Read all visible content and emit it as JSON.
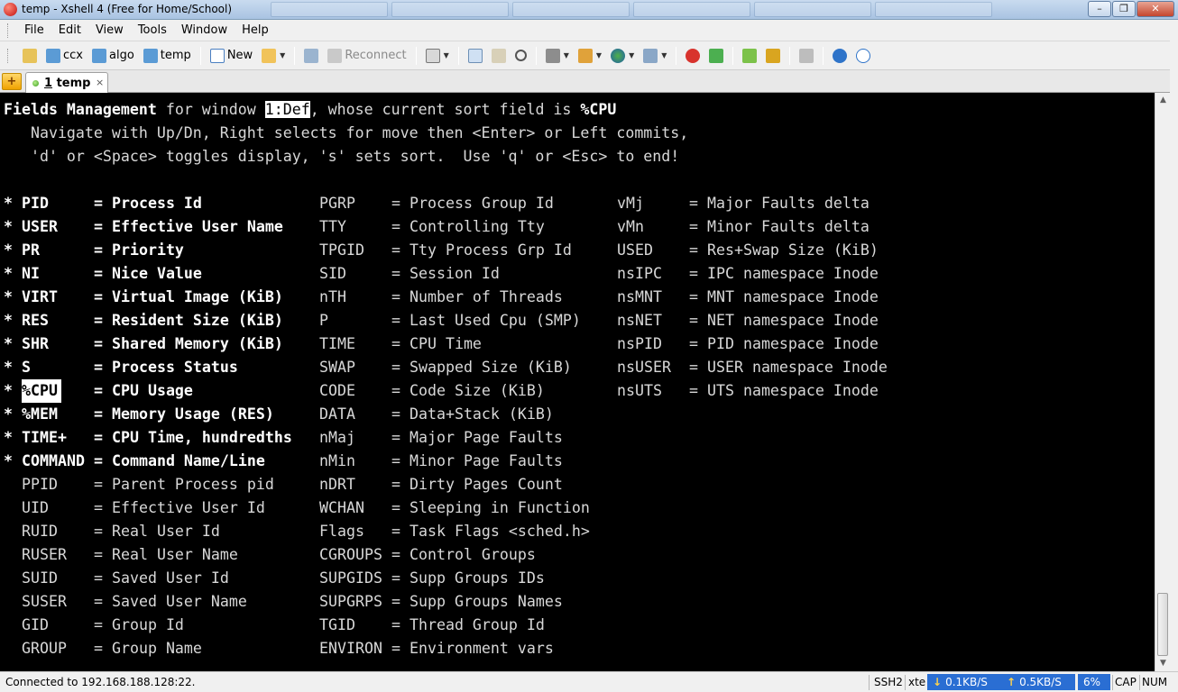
{
  "window": {
    "title": "temp - Xshell 4 (Free for Home/School)",
    "buttons": [
      "–",
      "❐",
      "✕"
    ]
  },
  "menu": [
    "File",
    "Edit",
    "View",
    "Tools",
    "Window",
    "Help"
  ],
  "toolbar": {
    "sessions": [
      "ccx",
      "algo",
      "temp"
    ],
    "new_label": "New",
    "reconnect_label": "Reconnect"
  },
  "tabs": [
    {
      "number": "1",
      "name": "temp",
      "close": "×"
    }
  ],
  "tab_add_symbol": "+",
  "terminal": {
    "header": {
      "prefix": "Fields Management",
      "mid": " for window ",
      "window_name": "1:Def",
      "suffix": ", whose current sort field is ",
      "sort_field": "%CPU"
    },
    "help_lines": [
      "   Navigate with Up/Dn, Right selects for move then <Enter> or Left commits,",
      "   'd' or <Space> toggles display, 's' sets sort.  Use 'q' or <Esc> to end!"
    ],
    "fields_col1": [
      {
        "star": "*",
        "name": "PID",
        "desc": "Process Id",
        "on": true
      },
      {
        "star": "*",
        "name": "USER",
        "desc": "Effective User Name",
        "on": true
      },
      {
        "star": "*",
        "name": "PR",
        "desc": "Priority",
        "on": true
      },
      {
        "star": "*",
        "name": "NI",
        "desc": "Nice Value",
        "on": true
      },
      {
        "star": "*",
        "name": "VIRT",
        "desc": "Virtual Image (KiB)",
        "on": true
      },
      {
        "star": "*",
        "name": "RES",
        "desc": "Resident Size (KiB)",
        "on": true
      },
      {
        "star": "*",
        "name": "SHR",
        "desc": "Shared Memory (KiB)",
        "on": true
      },
      {
        "star": "*",
        "name": "S",
        "desc": "Process Status",
        "on": true
      },
      {
        "star": "*",
        "name": "%CPU",
        "desc": "CPU Usage",
        "on": true,
        "selected": true
      },
      {
        "star": "*",
        "name": "%MEM",
        "desc": "Memory Usage (RES)",
        "on": true
      },
      {
        "star": "*",
        "name": "TIME+",
        "desc": "CPU Time, hundredths",
        "on": true
      },
      {
        "star": "*",
        "name": "COMMAND",
        "desc": "Command Name/Line",
        "on": true
      },
      {
        "star": "",
        "name": "PPID",
        "desc": "Parent Process pid",
        "on": false
      },
      {
        "star": "",
        "name": "UID",
        "desc": "Effective User Id",
        "on": false
      },
      {
        "star": "",
        "name": "RUID",
        "desc": "Real User Id",
        "on": false
      },
      {
        "star": "",
        "name": "RUSER",
        "desc": "Real User Name",
        "on": false
      },
      {
        "star": "",
        "name": "SUID",
        "desc": "Saved User Id",
        "on": false
      },
      {
        "star": "",
        "name": "SUSER",
        "desc": "Saved User Name",
        "on": false
      },
      {
        "star": "",
        "name": "GID",
        "desc": "Group Id",
        "on": false
      },
      {
        "star": "",
        "name": "GROUP",
        "desc": "Group Name",
        "on": false
      }
    ],
    "fields_col2": [
      {
        "name": "PGRP",
        "desc": "Process Group Id"
      },
      {
        "name": "TTY",
        "desc": "Controlling Tty"
      },
      {
        "name": "TPGID",
        "desc": "Tty Process Grp Id"
      },
      {
        "name": "SID",
        "desc": "Session Id"
      },
      {
        "name": "nTH",
        "desc": "Number of Threads"
      },
      {
        "name": "P",
        "desc": "Last Used Cpu (SMP)"
      },
      {
        "name": "TIME",
        "desc": "CPU Time"
      },
      {
        "name": "SWAP",
        "desc": "Swapped Size (KiB)"
      },
      {
        "name": "CODE",
        "desc": "Code Size (KiB)"
      },
      {
        "name": "DATA",
        "desc": "Data+Stack (KiB)"
      },
      {
        "name": "nMaj",
        "desc": "Major Page Faults"
      },
      {
        "name": "nMin",
        "desc": "Minor Page Faults"
      },
      {
        "name": "nDRT",
        "desc": "Dirty Pages Count"
      },
      {
        "name": "WCHAN",
        "desc": "Sleeping in Function"
      },
      {
        "name": "Flags",
        "desc": "Task Flags <sched.h>"
      },
      {
        "name": "CGROUPS",
        "desc": "Control Groups"
      },
      {
        "name": "SUPGIDS",
        "desc": "Supp Groups IDs"
      },
      {
        "name": "SUPGRPS",
        "desc": "Supp Groups Names"
      },
      {
        "name": "TGID",
        "desc": "Thread Group Id"
      },
      {
        "name": "ENVIRON",
        "desc": "Environment vars"
      }
    ],
    "fields_col3": [
      {
        "name": "vMj",
        "desc": "Major Faults delta"
      },
      {
        "name": "vMn",
        "desc": "Minor Faults delta"
      },
      {
        "name": "USED",
        "desc": "Res+Swap Size (KiB)"
      },
      {
        "name": "nsIPC",
        "desc": "IPC namespace Inode"
      },
      {
        "name": "nsMNT",
        "desc": "MNT namespace Inode"
      },
      {
        "name": "nsNET",
        "desc": "NET namespace Inode"
      },
      {
        "name": "nsPID",
        "desc": "PID namespace Inode"
      },
      {
        "name": "nsUSER",
        "desc": "USER namespace Inode"
      },
      {
        "name": "nsUTS",
        "desc": "UTS namespace Inode"
      }
    ]
  },
  "status": {
    "connection": "Connected to 192.168.188.128:22.",
    "protocol": "SSH2",
    "term": "xte",
    "download": "0.1KB/S",
    "upload": "0.5KB/S",
    "cpu": "6%",
    "caps": "CAP",
    "num": "NUM"
  },
  "colors": {
    "terminal_bg": "#000000",
    "terminal_fg": "#d8d8d8",
    "highlight_bg": "#ffffff",
    "status_accent": "#2a6ed3"
  }
}
